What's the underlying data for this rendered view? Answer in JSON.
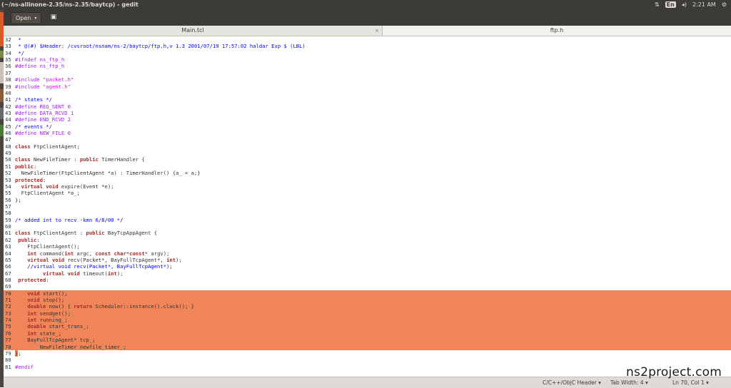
{
  "window": {
    "title": "(~/ns-allinone-2.35/ns-2.35/baytcp) - gedit",
    "tray": {
      "network_icon": "network-arrows-icon",
      "keyboard": "En",
      "volume_icon": "volume-icon",
      "time": "2:21 AM",
      "settings_icon": "gear-icon"
    }
  },
  "toolbar": {
    "open_label": "Open",
    "open_caret": "▾",
    "save_icon": "save-icon"
  },
  "tabs": [
    {
      "label": "Main.tcl",
      "close": "×",
      "active": false
    },
    {
      "label": "ftp.h",
      "active": true
    }
  ],
  "editor": {
    "lines": [
      {
        "n": "32",
        "text": " *"
      },
      {
        "n": "33",
        "text": " * @(#) $Header: /cvsroot/nsnam/ns-2/baytcp/ftp.h,v 1.3 2001/07/19 17:57:02 haldar Exp $ (LBL)"
      },
      {
        "n": "34",
        "text": " */"
      },
      {
        "n": "35",
        "text": "#ifndef ns_ftp_h"
      },
      {
        "n": "36",
        "text": "#define ns_ftp_h"
      },
      {
        "n": "37",
        "text": ""
      },
      {
        "n": "38",
        "text": "#include \"packet.h\""
      },
      {
        "n": "39",
        "text": "#include \"agent.h\""
      },
      {
        "n": "40",
        "text": ""
      },
      {
        "n": "41",
        "text": "/* states */"
      },
      {
        "n": "42",
        "text": "#define REQ_SENT 0"
      },
      {
        "n": "43",
        "text": "#define DATA_RCVD 1"
      },
      {
        "n": "44",
        "text": "#define END_RCVD 2"
      },
      {
        "n": "45",
        "text": "/* events */"
      },
      {
        "n": "46",
        "text": "#define NEW_FILE 0"
      },
      {
        "n": "47",
        "text": ""
      },
      {
        "n": "48",
        "text": "class FtpClientAgent;"
      },
      {
        "n": "49",
        "text": ""
      },
      {
        "n": "50",
        "text": "class NewFileTimer : public TimerHandler {"
      },
      {
        "n": "51",
        "text": "public:"
      },
      {
        "n": "52",
        "text": "  NewFileTimer(FtpClientAgent *a) : TimerHandler() {a_ = a;}"
      },
      {
        "n": "53",
        "text": "protected:"
      },
      {
        "n": "54",
        "text": "  virtual void expire(Event *e);"
      },
      {
        "n": "55",
        "text": "  FtpClientAgent *a_;"
      },
      {
        "n": "56",
        "text": "};"
      },
      {
        "n": "57",
        "text": ""
      },
      {
        "n": "58",
        "text": ""
      },
      {
        "n": "59",
        "text": "/* added int to recv -kmn 6/8/00 */"
      },
      {
        "n": "60",
        "text": ""
      },
      {
        "n": "61",
        "text": "class FtpClientAgent : public BayTcpAppAgent {"
      },
      {
        "n": "62",
        "text": " public:"
      },
      {
        "n": "63",
        "text": "    FtpClientAgent();"
      },
      {
        "n": "64",
        "text": "    int command(int argc, const char*const* argv);"
      },
      {
        "n": "65",
        "text": "    virtual void recv(Packet*, BayFullTcpAgent*, int);"
      },
      {
        "n": "66",
        "text": "    //virtual void recv(Packet*, BayFullTcpAgent*);"
      },
      {
        "n": "67",
        "text": "         virtual void timeout(int);"
      },
      {
        "n": "68",
        "text": " protected:"
      },
      {
        "n": "69",
        "text": ""
      },
      {
        "n": "70",
        "text": "    void start();"
      },
      {
        "n": "71",
        "text": "    void stop();"
      },
      {
        "n": "72",
        "text": "    double now() { return Scheduler::instance().clock(); }"
      },
      {
        "n": "73",
        "text": "    int sendget();"
      },
      {
        "n": "74",
        "text": "    int running_;"
      },
      {
        "n": "75",
        "text": "    double start_trans_;"
      },
      {
        "n": "76",
        "text": "    int state_;"
      },
      {
        "n": "77",
        "text": "    BayFullTcpAgent* tcp_;"
      },
      {
        "n": "78",
        "text": "        NewFileTimer newfile_timer_;"
      },
      {
        "n": "79",
        "text": "};"
      },
      {
        "n": "80",
        "text": ""
      },
      {
        "n": "81",
        "text": "#endif"
      }
    ],
    "selection_color": "#f0855a"
  },
  "statusbar": {
    "language": "C/C++/ObjC Header",
    "language_caret": "▾",
    "tab_width": "Tab Width: 4",
    "tab_caret": "▾",
    "position": "Ln 70, Col 1",
    "position_caret": "▾"
  },
  "watermark": "ns2project.com"
}
